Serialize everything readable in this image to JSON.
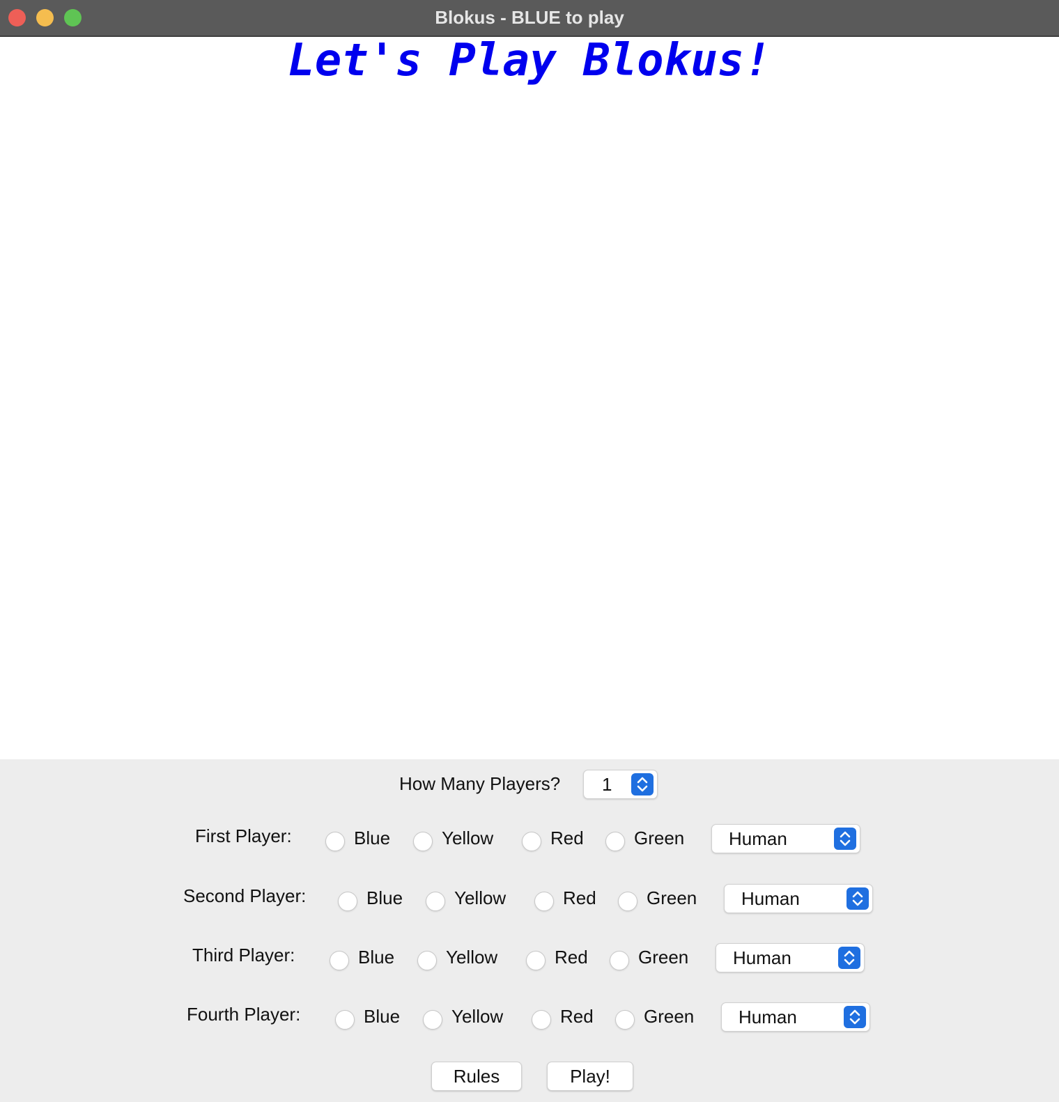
{
  "window": {
    "title": "Blokus - BLUE to play"
  },
  "banner": {
    "text": "Let's Play Blokus!",
    "color": "#0000ee"
  },
  "setup": {
    "player_count_label": "How Many Players?",
    "player_count_value": "1",
    "players": [
      {
        "label": "First Player:",
        "colors": [
          "Blue",
          "Yellow",
          "Red",
          "Green"
        ],
        "type": "Human"
      },
      {
        "label": "Second Player:",
        "colors": [
          "Blue",
          "Yellow",
          "Red",
          "Green"
        ],
        "type": "Human"
      },
      {
        "label": "Third Player:",
        "colors": [
          "Blue",
          "Yellow",
          "Red",
          "Green"
        ],
        "type": "Human"
      },
      {
        "label": "Fourth Player:",
        "colors": [
          "Blue",
          "Yellow",
          "Red",
          "Green"
        ],
        "type": "Human"
      }
    ],
    "rules_label": "Rules",
    "play_label": "Play!"
  },
  "icons": {
    "stepper": "up-down-chevron-icon"
  },
  "colors": {
    "accent": "#1f6fe0",
    "titlebar": "#5a5a5a",
    "panel": "#ededed"
  }
}
